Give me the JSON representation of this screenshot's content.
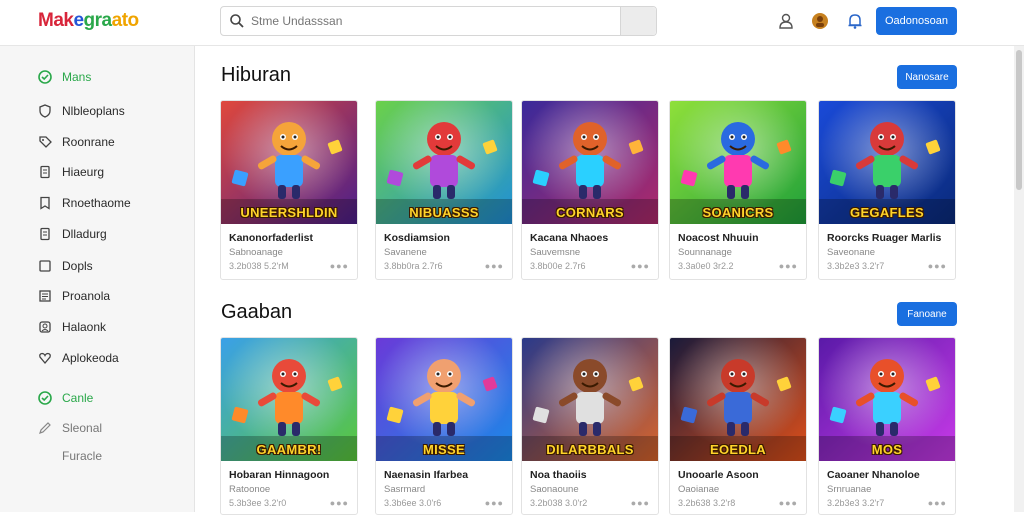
{
  "header": {
    "logo_parts": [
      "Mak",
      "e",
      "gra",
      "ato"
    ],
    "search_placeholder": "Stme Undasssan",
    "signin_label": "Oadonosoan"
  },
  "sidebar": {
    "items": [
      {
        "label": "Mans",
        "icon": "check-circle-icon",
        "state": "active"
      },
      {
        "label": "Nlbleoplans",
        "icon": "shield-icon",
        "state": "normal"
      },
      {
        "label": "Roonrane",
        "icon": "tag-icon",
        "state": "normal"
      },
      {
        "label": "Hiaeurg",
        "icon": "document-icon",
        "state": "normal"
      },
      {
        "label": "Rnoethaome",
        "icon": "bookmark-icon",
        "state": "normal"
      },
      {
        "label": "Dlladurg",
        "icon": "document-icon",
        "state": "normal"
      },
      {
        "label": "Dopls",
        "icon": "square-icon",
        "state": "normal"
      },
      {
        "label": "Proanola",
        "icon": "list-icon",
        "state": "normal"
      },
      {
        "label": "Halaonk",
        "icon": "image-icon",
        "state": "normal"
      },
      {
        "label": "Aplokeoda",
        "icon": "heart-icon",
        "state": "normal"
      },
      {
        "label": "Canle",
        "icon": "check-circle-icon",
        "state": "active"
      },
      {
        "label": "Sleonal",
        "icon": "pencil-icon",
        "state": "muted"
      },
      {
        "label": "Furacle",
        "icon": "",
        "state": "muted"
      }
    ]
  },
  "sections": [
    {
      "title": "Hiburan",
      "button": "Nanosare",
      "cards": [
        {
          "caption": "UNEERSHLDIN",
          "title": "Kanonorfaderlist",
          "sub": "Sabnoanage",
          "meta": "3.2b038 5.2'rM",
          "scene": "hero"
        },
        {
          "caption": "NIBUASSS",
          "title": "Kosdiamsion",
          "sub": "Savanene",
          "meta": "3.8bb0ra 2.7r6",
          "scene": "jump"
        },
        {
          "caption": "CORNARS",
          "title": "Kacana Nhaoes",
          "sub": "Sauvemsne",
          "meta": "3.8b00e 2.7r6",
          "scene": "guitar"
        },
        {
          "caption": "SOANICRS",
          "title": "Noacost Nhuuin",
          "sub": "Sounnanage",
          "meta": "3.3a0e0 3r2.2",
          "scene": "cubes"
        },
        {
          "caption": "GEGAFLES",
          "title": "Roorcks Ruager Marlis",
          "sub": "Saveonane",
          "meta": "3.3b2e3 3.2'r7",
          "scene": "squad"
        }
      ]
    },
    {
      "title": "Gaaban",
      "button": "Fanoane",
      "cards": [
        {
          "caption": "GAAMBR!",
          "title": "Hobaran Hinnagoon",
          "sub": "Ratoonoe",
          "meta": "5.3b3ee 3.2'r0",
          "scene": "field"
        },
        {
          "caption": "MISSE",
          "title": "Naenasin Ifarbea",
          "sub": "Sasrmard",
          "meta": "3.3b6ee 3.0'r6",
          "scene": "girl"
        },
        {
          "caption": "DILARBBALS",
          "title": "Noa thaoiis",
          "sub": "Saonaoune",
          "meta": "3.2b038 3.0'r2",
          "scene": "band"
        },
        {
          "caption": "EOEDLA",
          "title": "Unooarle Asoon",
          "sub": "Oaoianae",
          "meta": "3.2b638 3.2'r8",
          "scene": "team"
        },
        {
          "caption": "MOS",
          "title": "Caoaner Nhanoloe",
          "sub": "Srnruanae",
          "meta": "3.2b3e3 3.2'r7",
          "scene": "purple"
        }
      ]
    }
  ],
  "colors": {
    "accent": "#1a6fe0",
    "active_green": "#2aa84a"
  }
}
